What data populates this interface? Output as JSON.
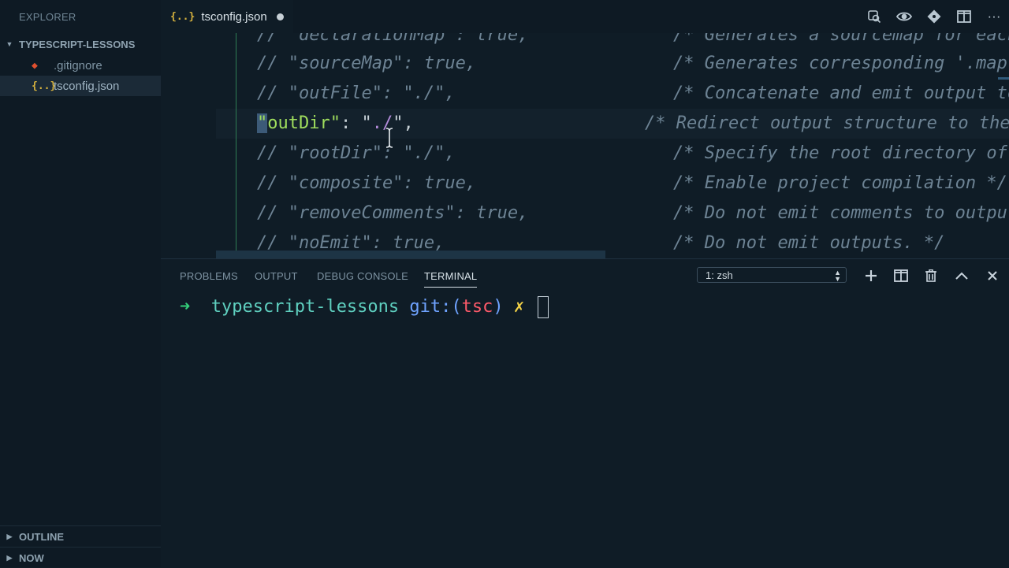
{
  "sidebar": {
    "title": "EXPLORER",
    "folder": "TYPESCRIPT-LESSONS",
    "files": [
      {
        "icon": "◆",
        "name": ".gitignore"
      },
      {
        "icon": "{..}",
        "name": "tsconfig.json"
      }
    ],
    "sections": [
      "OUTLINE",
      "NOW"
    ]
  },
  "tab": {
    "icon": "{..}",
    "name": "tsconfig.json"
  },
  "editor": {
    "lines": [
      {
        "code": "// \"declarationMap\": true,",
        "comment": "/* Generates a sourcemap for each"
      },
      {
        "code": "// \"sourceMap\": true,",
        "comment": "/* Generates corresponding '.map'"
      },
      {
        "code": "// \"outFile\": \"./\",",
        "comment": "/* Concatenate and emit output to"
      },
      {
        "code": "",
        "comment": "/* Redirect output structure to the d"
      },
      {
        "code": "// \"rootDir\": \"./\",",
        "comment": "/* Specify the root directory of i"
      },
      {
        "code": "// \"composite\": true,",
        "comment": "/* Enable project compilation */"
      },
      {
        "code": "// \"removeComments\": true,",
        "comment": "/* Do not emit comments to output."
      },
      {
        "code": "// \"noEmit\": true,",
        "comment": "/* Do not emit outputs. */"
      }
    ],
    "active_line": {
      "q1": "\"",
      "key": "outDir",
      "q2": "\"",
      "colon": ": ",
      "q3": "\"",
      "val": "./",
      "q4": "\"",
      "comma": ","
    }
  },
  "panel": {
    "tabs": [
      "PROBLEMS",
      "OUTPUT",
      "DEBUG CONSOLE",
      "TERMINAL"
    ],
    "active_tab": "TERMINAL",
    "terminal_select": "1: zsh"
  },
  "terminal": {
    "arrow": "➜",
    "dir": "typescript-lessons",
    "git": "git:(",
    "branch": "tsc",
    "git_close": ")",
    "dirty": "✗"
  }
}
